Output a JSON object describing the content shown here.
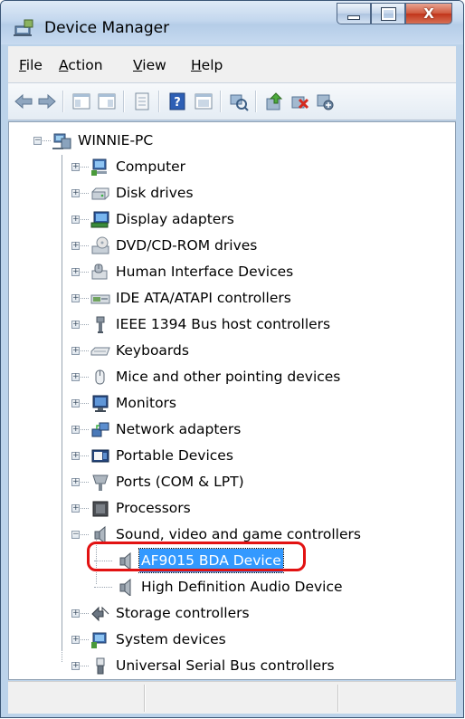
{
  "window": {
    "title": "Device Manager"
  },
  "menu": [
    {
      "label": "File",
      "key": "F",
      "rest": "ile"
    },
    {
      "label": "Action",
      "key": "A",
      "rest": "ction"
    },
    {
      "label": "View",
      "key": "V",
      "rest": "iew"
    },
    {
      "label": "Help",
      "key": "H",
      "rest": "elp"
    }
  ],
  "toolbar": [
    "back-icon",
    "forward-icon",
    "console-tree-icon",
    "properties-icon",
    "help-icon",
    "action-pane-icon",
    "scan-hardware-icon",
    "update-driver-icon",
    "uninstall-icon",
    "disable-icon"
  ],
  "tree": {
    "root": "WINNIE-PC",
    "categories": [
      "Computer",
      "Disk drives",
      "Display adapters",
      "DVD/CD-ROM drives",
      "Human Interface Devices",
      "IDE ATA/ATAPI controllers",
      "IEEE 1394 Bus host controllers",
      "Keyboards",
      "Mice and other pointing devices",
      "Monitors",
      "Network adapters",
      "Portable Devices",
      "Ports (COM & LPT)",
      "Processors",
      "Sound, video and game controllers"
    ],
    "sound_children": [
      "AF9015 BDA Device",
      "High Definition Audio Device"
    ],
    "after": [
      "Storage controllers",
      "System devices",
      "Universal Serial Bus controllers"
    ],
    "selected": "AF9015 BDA Device"
  },
  "colors": {
    "selection": "#3399ff",
    "highlight_ring": "#e21212",
    "titlebar": "#c3d7ee"
  }
}
